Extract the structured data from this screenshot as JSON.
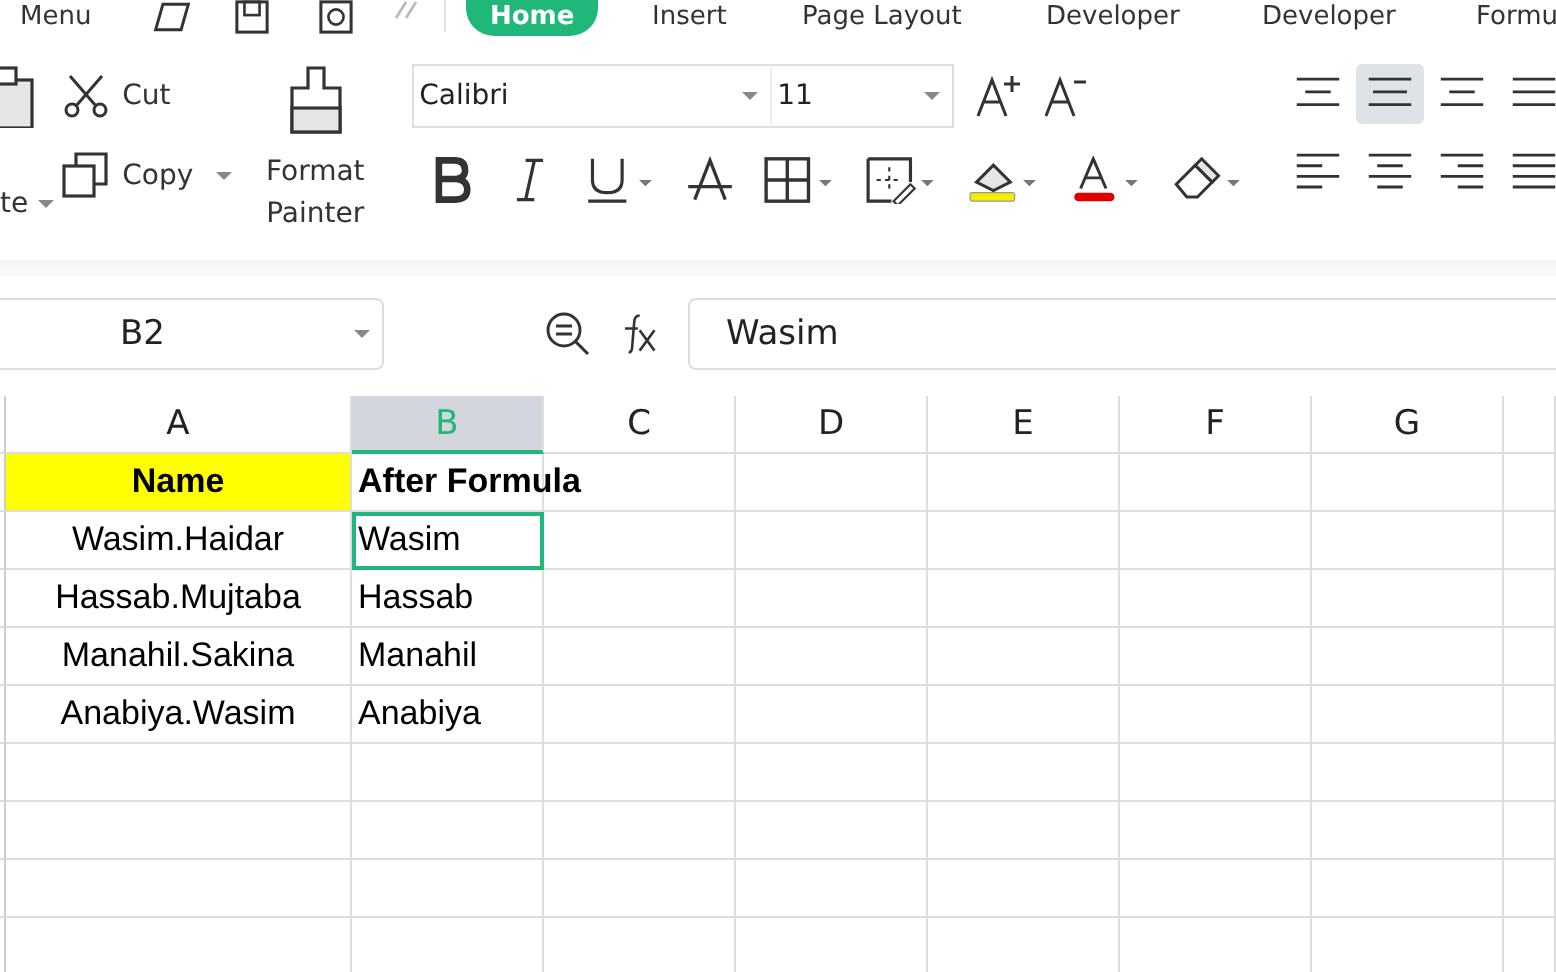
{
  "menu_tabs": [
    {
      "label": "Menu",
      "selected": false
    },
    {
      "label": "Home",
      "selected": true
    },
    {
      "label": "Insert",
      "selected": false
    },
    {
      "label": "Page Layout",
      "selected": false
    },
    {
      "label": "Developer",
      "selected": false
    },
    {
      "label": "Developer",
      "selected": false
    },
    {
      "label": "Formu",
      "selected": false
    }
  ],
  "ribbon": {
    "paste_label": "te",
    "cut_label": "Cut",
    "copy_label": "Copy",
    "format_painter_label": "Format Painter",
    "font": "Calibri",
    "font_size": "11",
    "alignments": [
      {
        "selected": false
      },
      {
        "selected": true
      },
      {
        "selected": false
      },
      {
        "selected": false
      },
      {
        "selected": false
      },
      {
        "selected": false
      },
      {
        "selected": false
      },
      {
        "selected": false
      }
    ]
  },
  "formula_bar": {
    "name_box": "B2",
    "value": "Wasim"
  },
  "sheet": {
    "columns": [
      {
        "label": "A",
        "selected": false
      },
      {
        "label": "B",
        "selected": true
      },
      {
        "label": "C",
        "selected": false
      },
      {
        "label": "D",
        "selected": false
      },
      {
        "label": "E",
        "selected": false
      },
      {
        "label": "F",
        "selected": false
      },
      {
        "label": "G",
        "selected": false
      }
    ],
    "rows": [
      {
        "bold": true,
        "cells": [
          {
            "text": "Name",
            "highlighted": true,
            "selected": false
          },
          {
            "text": "After Formula",
            "highlighted": false,
            "selected": false
          }
        ]
      },
      {
        "bold": false,
        "cells": [
          {
            "text": "Wasim.Haidar",
            "highlighted": false,
            "selected": false
          },
          {
            "text": "Wasim",
            "highlighted": false,
            "selected": true
          }
        ]
      },
      {
        "bold": false,
        "cells": [
          {
            "text": "Hassab.Mujtaba",
            "highlighted": false,
            "selected": false
          },
          {
            "text": "Hassab",
            "highlighted": false,
            "selected": false
          }
        ]
      },
      {
        "bold": false,
        "cells": [
          {
            "text": "Manahil.Sakina",
            "highlighted": false,
            "selected": false
          },
          {
            "text": "Manahil",
            "highlighted": false,
            "selected": false
          }
        ]
      },
      {
        "bold": false,
        "cells": [
          {
            "text": "Anabiya.Wasim",
            "highlighted": false,
            "selected": false
          },
          {
            "text": "Anabiya",
            "highlighted": false,
            "selected": false
          }
        ]
      }
    ]
  }
}
